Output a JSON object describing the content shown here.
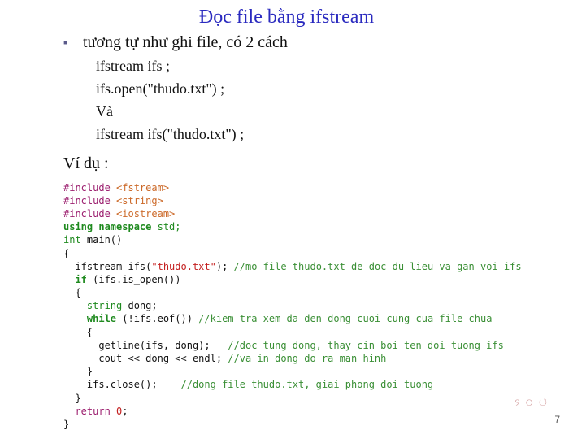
{
  "title": "Đọc file bằng ifstream",
  "bullet": {
    "mark": "▪",
    "text": "tương tự như ghi file, có 2 cách"
  },
  "plain_code": {
    "l1": "ifstream ifs ;",
    "l2": "ifs.open(\"thudo.txt\") ;",
    "l3": "Và",
    "l4": "ifstream ifs(\"thudo.txt\") ;"
  },
  "example_label": "Ví dụ :",
  "code": {
    "inc1_a": "#include ",
    "inc1_b": "<fstream>",
    "inc2_a": "#include ",
    "inc2_b": "<string>",
    "inc3_a": "#include ",
    "inc3_b": "<iostream>",
    "using_a": "using namespace",
    "using_b": " std;",
    "int": "int",
    "main_sig": " main()",
    "ob": "{",
    "ifs_decl": "  ifstream ifs(",
    "ifs_str": "\"thudo.txt\"",
    "ifs_end": "); ",
    "ifs_cmt": "//mo file thudo.txt de doc du lieu va gan voi ifs",
    "if_kw": "if",
    "if_cond": " (ifs.is_open())",
    "ob2": "  {",
    "str_kw": "string",
    "dong_decl": " dong;",
    "while_kw": "while",
    "while_cond": " (!ifs.eof()) ",
    "while_cmt": "//kiem tra xem da den dong cuoi cung cua file chua",
    "ob3": "    {",
    "getline": "      getline(ifs, dong);   ",
    "getline_cmt": "//doc tung dong, thay cin boi ten doi tuong ifs",
    "cout": "      cout << dong << endl; ",
    "cout_cmt": "//va in dong do ra man hinh",
    "cb3": "    }",
    "close": "    ifs.close();    ",
    "close_cmt": "//dong file thudo.txt, giai phong doi tuong",
    "cb2": "  }",
    "return_kw": "return",
    "return_rest": " ",
    "return_num": "0",
    "return_semi": ";",
    "cb": "}"
  },
  "nav_icon": "୨ ୦ ↺",
  "page_number": "7"
}
